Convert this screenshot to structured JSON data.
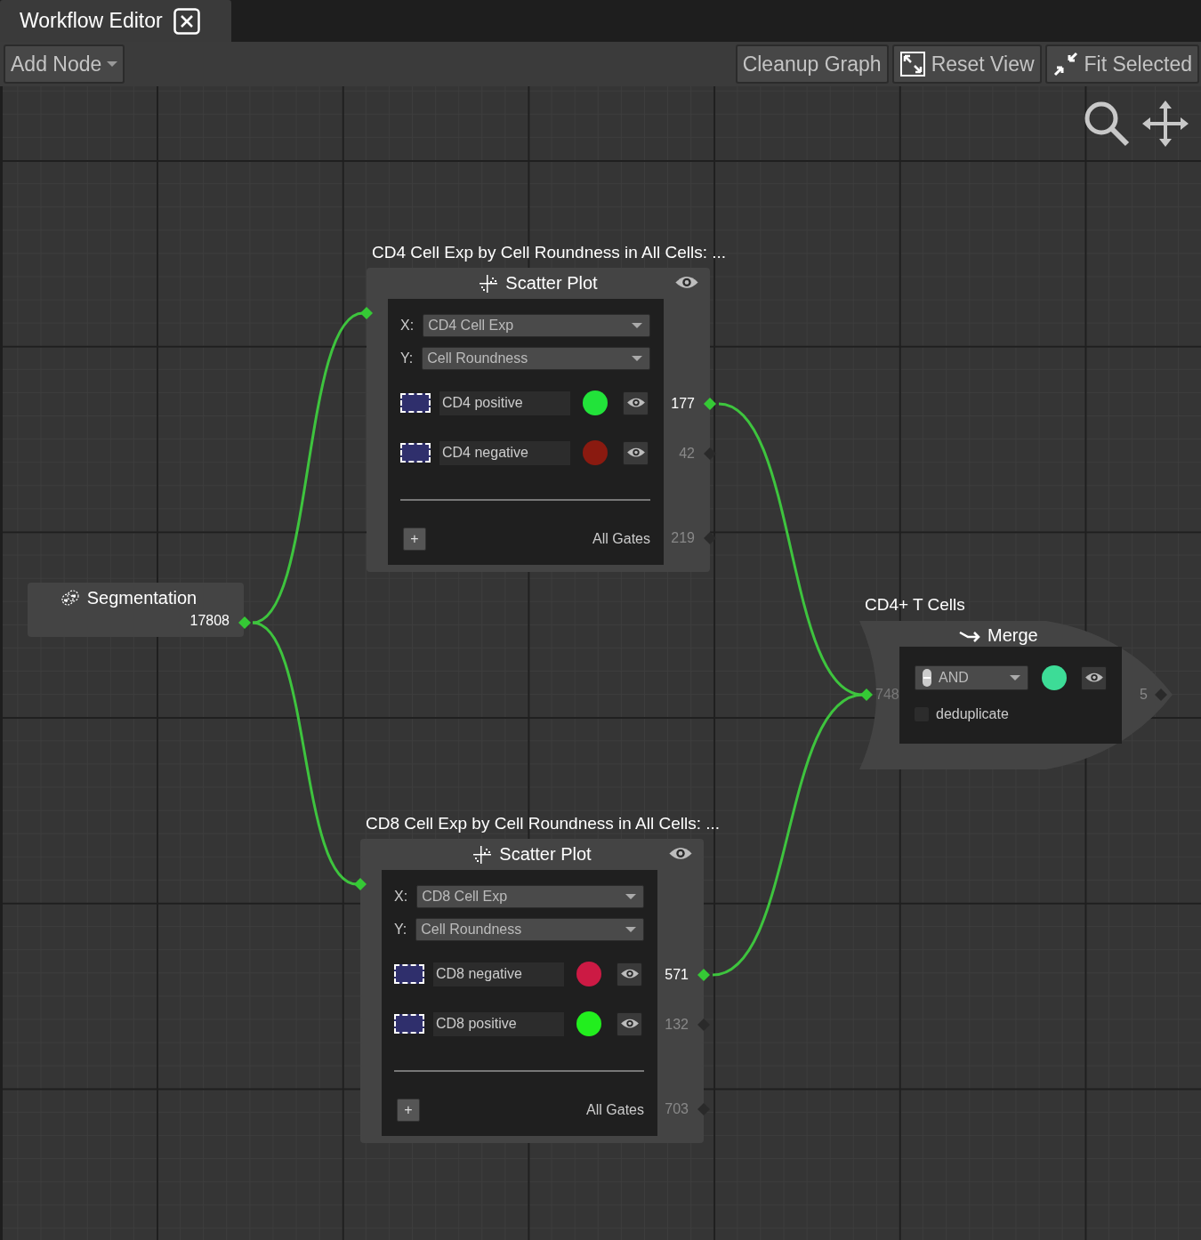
{
  "tab": {
    "title": "Workflow Editor"
  },
  "toolbar": {
    "add_node": "Add Node",
    "actions": [
      {
        "label": "Cleanup Graph",
        "kind": "text"
      },
      {
        "label": "Reset View",
        "kind": "expand"
      },
      {
        "label": "Fit Selected",
        "kind": "shrink"
      }
    ]
  },
  "segmentation": {
    "type": "Segmentation",
    "count": "17808",
    "connected": true
  },
  "scatter_plots": [
    {
      "title": "CD4 Cell Exp by Cell Roundness in All Cells: ...",
      "type": "Scatter Plot",
      "input_connected": true,
      "x_label": "X:",
      "x_axis": "CD4 Cell Exp",
      "y_label": "Y:",
      "y_axis": "Cell Roundness",
      "gates": [
        {
          "name": "CD4 positive",
          "color": "#22e33a",
          "count": "177",
          "connected": true
        },
        {
          "name": "CD4 negative",
          "color": "#8a1a10",
          "count": "42",
          "connected": false
        }
      ],
      "add": "+",
      "all_gates": "All Gates",
      "total": "219",
      "total_connected": false
    },
    {
      "title": "CD8 Cell Exp by Cell Roundness in All Cells: ...",
      "type": "Scatter Plot",
      "input_connected": true,
      "x_label": "X:",
      "x_axis": "CD8 Cell Exp",
      "y_label": "Y:",
      "y_axis": "Cell Roundness",
      "gates": [
        {
          "name": "CD8 negative",
          "color": "#cc1a44",
          "count": "571",
          "connected": true
        },
        {
          "name": "CD8 positive",
          "color": "#22ee1e",
          "count": "132",
          "connected": false
        }
      ],
      "add": "+",
      "all_gates": "All Gates",
      "total": "703",
      "total_connected": false
    }
  ],
  "merge": {
    "title": "CD4+ T Cells",
    "type": "Merge",
    "mode": "AND",
    "color": "#3ddc97",
    "deduplicate": false,
    "deduplicate_label": "deduplicate",
    "input_count": "748",
    "input_connected": true,
    "output_count": "5",
    "output_connected": false
  }
}
